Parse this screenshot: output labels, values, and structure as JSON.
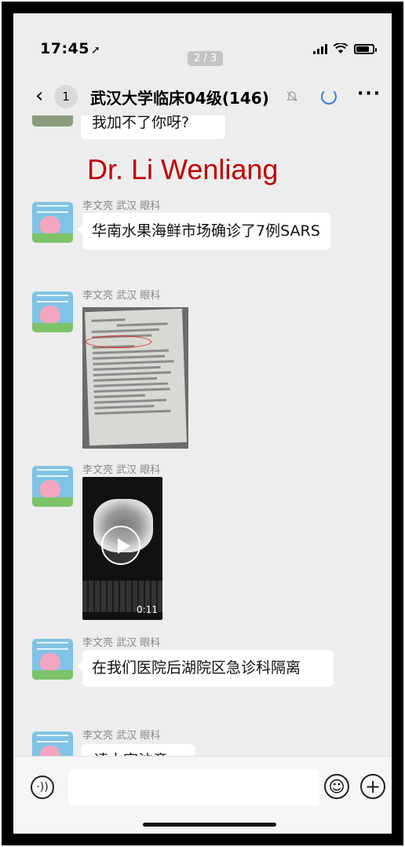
{
  "status_bar": {
    "time": "17:45",
    "location_arrow": "➚"
  },
  "page_indicator": "2 / 3",
  "header": {
    "back_icon": "‹",
    "unread_count": "1",
    "title": "武汉大学临床04级(146)",
    "more_icon": "···"
  },
  "overlay_label": "Dr. Li Wenliang",
  "messages": [
    {
      "type": "text",
      "text": "我加不了你呀?",
      "partial": true
    },
    {
      "type": "text",
      "sender": "李文亮 武汉 眼科",
      "text": "华南水果海鲜市场确诊了7例SARS"
    },
    {
      "type": "image",
      "sender": "李文亮 武汉 眼科"
    },
    {
      "type": "video",
      "sender": "李文亮 武汉 眼科",
      "duration": "0:11"
    },
    {
      "type": "text",
      "sender": "李文亮 武汉 眼科",
      "text": "在我们医院后湖院区急诊科隔离"
    },
    {
      "type": "text",
      "sender": "李文亮 武汉 眼科",
      "text": "请大家注意",
      "partial": true
    }
  ],
  "input_bar": {
    "voice_icon": "·))",
    "emoji_icon": "☺",
    "plus_icon": "+"
  }
}
